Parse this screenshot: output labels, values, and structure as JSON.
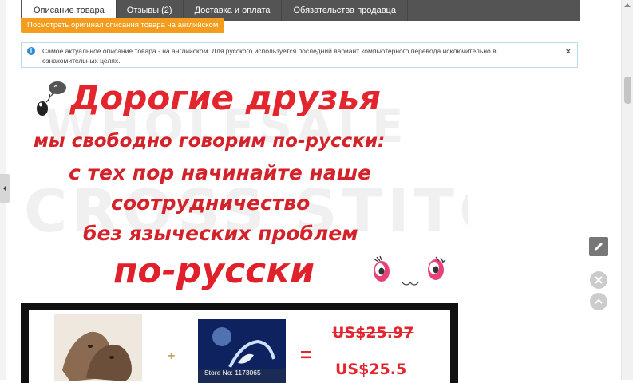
{
  "tabs": [
    {
      "label": "Описание товара",
      "active": true
    },
    {
      "label": "Отзывы (2)",
      "active": false
    },
    {
      "label": "Доставка и оплата",
      "active": false
    },
    {
      "label": "Обязательства продавца",
      "active": false
    }
  ],
  "orange_button": "Посмотреть оригинал описания товара на английском",
  "notice": {
    "text": "Самое актуальное описание товара - на английском. Для русского используется последний вариант компьютерного перевода исключительно в ознакомительных целях.",
    "close": "×",
    "icon": "info-icon"
  },
  "banner": {
    "watermark_line1": "WHOLESALE",
    "watermark_line2": "CROSS STITCH",
    "line1": "Дорогие друзья",
    "line2": "мы свободно говорим по-русски:",
    "line3": "с тех пор начинайте наше",
    "line4": "соотрудничество",
    "line5": "без языческих проблем",
    "line6": "по-русски"
  },
  "products": {
    "plus": "+",
    "equals": "=",
    "price_old": "US$25.97",
    "price_new": "US$25.5",
    "store_no": "Store No: 1173065"
  },
  "colors": {
    "accent_red": "#e3262e",
    "orange": "#f39c1e",
    "tabs_bg": "#545454",
    "info_blue": "#2d8bd0"
  }
}
